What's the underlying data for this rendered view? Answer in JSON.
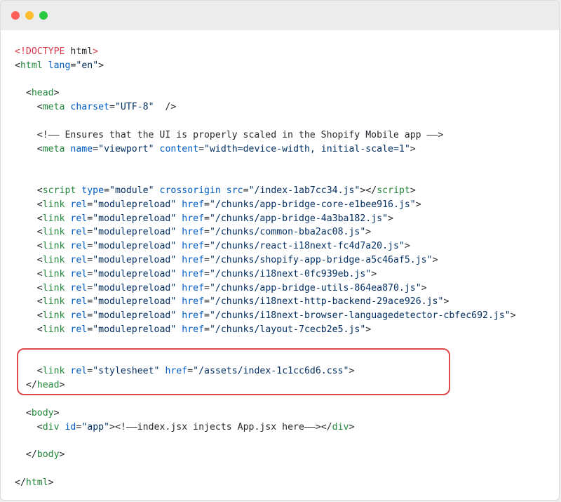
{
  "window": {
    "controls": {
      "close_color": "#ff5f57",
      "minimize_color": "#febc2e",
      "maximize_color": "#28c840"
    }
  },
  "code": {
    "lines": [
      [
        {
          "t": "<!DOCTYPE",
          "c": "c-doctype"
        },
        {
          "t": " html",
          "c": "c-text"
        },
        {
          "t": ">",
          "c": "c-doctype"
        }
      ],
      [
        {
          "t": "<",
          "c": "c-punct"
        },
        {
          "t": "html",
          "c": "c-tag"
        },
        {
          "t": " ",
          "c": "c-text"
        },
        {
          "t": "lang",
          "c": "c-attr"
        },
        {
          "t": "=",
          "c": "c-punct"
        },
        {
          "t": "\"en\"",
          "c": "c-str"
        },
        {
          "t": ">",
          "c": "c-punct"
        }
      ],
      [],
      [
        {
          "t": "  <",
          "c": "c-punct"
        },
        {
          "t": "head",
          "c": "c-tag"
        },
        {
          "t": ">",
          "c": "c-punct"
        }
      ],
      [
        {
          "t": "    <",
          "c": "c-punct"
        },
        {
          "t": "meta",
          "c": "c-tag"
        },
        {
          "t": " ",
          "c": "c-text"
        },
        {
          "t": "charset",
          "c": "c-attr"
        },
        {
          "t": "=",
          "c": "c-punct"
        },
        {
          "t": "\"UTF-8\"",
          "c": "c-str"
        },
        {
          "t": "  />",
          "c": "c-punct"
        }
      ],
      [],
      [
        {
          "t": "    <!—— Ensures that the UI is properly scaled in the Shopify Mobile app ——>",
          "c": "c-comment"
        }
      ],
      [
        {
          "t": "    <",
          "c": "c-punct"
        },
        {
          "t": "meta",
          "c": "c-tag"
        },
        {
          "t": " ",
          "c": "c-text"
        },
        {
          "t": "name",
          "c": "c-attr"
        },
        {
          "t": "=",
          "c": "c-punct"
        },
        {
          "t": "\"viewport\"",
          "c": "c-str"
        },
        {
          "t": " ",
          "c": "c-text"
        },
        {
          "t": "content",
          "c": "c-attr"
        },
        {
          "t": "=",
          "c": "c-punct"
        },
        {
          "t": "\"width=device-width, initial-scale=1\"",
          "c": "c-str"
        },
        {
          "t": ">",
          "c": "c-punct"
        }
      ],
      [],
      [],
      [
        {
          "t": "    <",
          "c": "c-punct"
        },
        {
          "t": "script",
          "c": "c-tag"
        },
        {
          "t": " ",
          "c": "c-text"
        },
        {
          "t": "type",
          "c": "c-attr"
        },
        {
          "t": "=",
          "c": "c-punct"
        },
        {
          "t": "\"module\"",
          "c": "c-str"
        },
        {
          "t": " ",
          "c": "c-text"
        },
        {
          "t": "crossorigin",
          "c": "c-attr"
        },
        {
          "t": " ",
          "c": "c-text"
        },
        {
          "t": "src",
          "c": "c-attr"
        },
        {
          "t": "=",
          "c": "c-punct"
        },
        {
          "t": "\"/index-1ab7cc34.js\"",
          "c": "c-str"
        },
        {
          "t": "></",
          "c": "c-punct"
        },
        {
          "t": "script",
          "c": "c-tag"
        },
        {
          "t": ">",
          "c": "c-punct"
        }
      ],
      [
        {
          "t": "    <",
          "c": "c-punct"
        },
        {
          "t": "link",
          "c": "c-tag"
        },
        {
          "t": " ",
          "c": "c-text"
        },
        {
          "t": "rel",
          "c": "c-attr"
        },
        {
          "t": "=",
          "c": "c-punct"
        },
        {
          "t": "\"modulepreload\"",
          "c": "c-str"
        },
        {
          "t": " ",
          "c": "c-text"
        },
        {
          "t": "href",
          "c": "c-attr"
        },
        {
          "t": "=",
          "c": "c-punct"
        },
        {
          "t": "\"/chunks/app-bridge-core-e1bee916.js\"",
          "c": "c-str"
        },
        {
          "t": ">",
          "c": "c-punct"
        }
      ],
      [
        {
          "t": "    <",
          "c": "c-punct"
        },
        {
          "t": "link",
          "c": "c-tag"
        },
        {
          "t": " ",
          "c": "c-text"
        },
        {
          "t": "rel",
          "c": "c-attr"
        },
        {
          "t": "=",
          "c": "c-punct"
        },
        {
          "t": "\"modulepreload\"",
          "c": "c-str"
        },
        {
          "t": " ",
          "c": "c-text"
        },
        {
          "t": "href",
          "c": "c-attr"
        },
        {
          "t": "=",
          "c": "c-punct"
        },
        {
          "t": "\"/chunks/app-bridge-4a3ba182.js\"",
          "c": "c-str"
        },
        {
          "t": ">",
          "c": "c-punct"
        }
      ],
      [
        {
          "t": "    <",
          "c": "c-punct"
        },
        {
          "t": "link",
          "c": "c-tag"
        },
        {
          "t": " ",
          "c": "c-text"
        },
        {
          "t": "rel",
          "c": "c-attr"
        },
        {
          "t": "=",
          "c": "c-punct"
        },
        {
          "t": "\"modulepreload\"",
          "c": "c-str"
        },
        {
          "t": " ",
          "c": "c-text"
        },
        {
          "t": "href",
          "c": "c-attr"
        },
        {
          "t": "=",
          "c": "c-punct"
        },
        {
          "t": "\"/chunks/common-bba2ac08.js\"",
          "c": "c-str"
        },
        {
          "t": ">",
          "c": "c-punct"
        }
      ],
      [
        {
          "t": "    <",
          "c": "c-punct"
        },
        {
          "t": "link",
          "c": "c-tag"
        },
        {
          "t": " ",
          "c": "c-text"
        },
        {
          "t": "rel",
          "c": "c-attr"
        },
        {
          "t": "=",
          "c": "c-punct"
        },
        {
          "t": "\"modulepreload\"",
          "c": "c-str"
        },
        {
          "t": " ",
          "c": "c-text"
        },
        {
          "t": "href",
          "c": "c-attr"
        },
        {
          "t": "=",
          "c": "c-punct"
        },
        {
          "t": "\"/chunks/react-i18next-fc4d7a20.js\"",
          "c": "c-str"
        },
        {
          "t": ">",
          "c": "c-punct"
        }
      ],
      [
        {
          "t": "    <",
          "c": "c-punct"
        },
        {
          "t": "link",
          "c": "c-tag"
        },
        {
          "t": " ",
          "c": "c-text"
        },
        {
          "t": "rel",
          "c": "c-attr"
        },
        {
          "t": "=",
          "c": "c-punct"
        },
        {
          "t": "\"modulepreload\"",
          "c": "c-str"
        },
        {
          "t": " ",
          "c": "c-text"
        },
        {
          "t": "href",
          "c": "c-attr"
        },
        {
          "t": "=",
          "c": "c-punct"
        },
        {
          "t": "\"/chunks/shopify-app-bridge-a5c46af5.js\"",
          "c": "c-str"
        },
        {
          "t": ">",
          "c": "c-punct"
        }
      ],
      [
        {
          "t": "    <",
          "c": "c-punct"
        },
        {
          "t": "link",
          "c": "c-tag"
        },
        {
          "t": " ",
          "c": "c-text"
        },
        {
          "t": "rel",
          "c": "c-attr"
        },
        {
          "t": "=",
          "c": "c-punct"
        },
        {
          "t": "\"modulepreload\"",
          "c": "c-str"
        },
        {
          "t": " ",
          "c": "c-text"
        },
        {
          "t": "href",
          "c": "c-attr"
        },
        {
          "t": "=",
          "c": "c-punct"
        },
        {
          "t": "\"/chunks/i18next-0fc939eb.js\"",
          "c": "c-str"
        },
        {
          "t": ">",
          "c": "c-punct"
        }
      ],
      [
        {
          "t": "    <",
          "c": "c-punct"
        },
        {
          "t": "link",
          "c": "c-tag"
        },
        {
          "t": " ",
          "c": "c-text"
        },
        {
          "t": "rel",
          "c": "c-attr"
        },
        {
          "t": "=",
          "c": "c-punct"
        },
        {
          "t": "\"modulepreload\"",
          "c": "c-str"
        },
        {
          "t": " ",
          "c": "c-text"
        },
        {
          "t": "href",
          "c": "c-attr"
        },
        {
          "t": "=",
          "c": "c-punct"
        },
        {
          "t": "\"/chunks/app-bridge-utils-864ea870.js\"",
          "c": "c-str"
        },
        {
          "t": ">",
          "c": "c-punct"
        }
      ],
      [
        {
          "t": "    <",
          "c": "c-punct"
        },
        {
          "t": "link",
          "c": "c-tag"
        },
        {
          "t": " ",
          "c": "c-text"
        },
        {
          "t": "rel",
          "c": "c-attr"
        },
        {
          "t": "=",
          "c": "c-punct"
        },
        {
          "t": "\"modulepreload\"",
          "c": "c-str"
        },
        {
          "t": " ",
          "c": "c-text"
        },
        {
          "t": "href",
          "c": "c-attr"
        },
        {
          "t": "=",
          "c": "c-punct"
        },
        {
          "t": "\"/chunks/i18next-http-backend-29ace926.js\"",
          "c": "c-str"
        },
        {
          "t": ">",
          "c": "c-punct"
        }
      ],
      [
        {
          "t": "    <",
          "c": "c-punct"
        },
        {
          "t": "link",
          "c": "c-tag"
        },
        {
          "t": " ",
          "c": "c-text"
        },
        {
          "t": "rel",
          "c": "c-attr"
        },
        {
          "t": "=",
          "c": "c-punct"
        },
        {
          "t": "\"modulepreload\"",
          "c": "c-str"
        },
        {
          "t": " ",
          "c": "c-text"
        },
        {
          "t": "href",
          "c": "c-attr"
        },
        {
          "t": "=",
          "c": "c-punct"
        },
        {
          "t": "\"/chunks/i18next-browser-languagedetector-cbfec692.js\"",
          "c": "c-str"
        },
        {
          "t": ">",
          "c": "c-punct"
        }
      ],
      [
        {
          "t": "    <",
          "c": "c-punct"
        },
        {
          "t": "link",
          "c": "c-tag"
        },
        {
          "t": " ",
          "c": "c-text"
        },
        {
          "t": "rel",
          "c": "c-attr"
        },
        {
          "t": "=",
          "c": "c-punct"
        },
        {
          "t": "\"modulepreload\"",
          "c": "c-str"
        },
        {
          "t": " ",
          "c": "c-text"
        },
        {
          "t": "href",
          "c": "c-attr"
        },
        {
          "t": "=",
          "c": "c-punct"
        },
        {
          "t": "\"/chunks/layout-7cecb2e5.js\"",
          "c": "c-str"
        },
        {
          "t": ">",
          "c": "c-punct"
        }
      ],
      [],
      [],
      [
        {
          "t": "    <",
          "c": "c-punct"
        },
        {
          "t": "link",
          "c": "c-tag"
        },
        {
          "t": " ",
          "c": "c-text"
        },
        {
          "t": "rel",
          "c": "c-attr"
        },
        {
          "t": "=",
          "c": "c-punct"
        },
        {
          "t": "\"stylesheet\"",
          "c": "c-str"
        },
        {
          "t": " ",
          "c": "c-text"
        },
        {
          "t": "href",
          "c": "c-attr"
        },
        {
          "t": "=",
          "c": "c-punct"
        },
        {
          "t": "\"/assets/index-1c1cc6d6.css\"",
          "c": "c-str"
        },
        {
          "t": ">",
          "c": "c-punct"
        }
      ],
      [
        {
          "t": "  </",
          "c": "c-punct"
        },
        {
          "t": "head",
          "c": "c-tag"
        },
        {
          "t": ">",
          "c": "c-punct"
        }
      ],
      [],
      [
        {
          "t": "  <",
          "c": "c-punct"
        },
        {
          "t": "body",
          "c": "c-tag"
        },
        {
          "t": ">",
          "c": "c-punct"
        }
      ],
      [
        {
          "t": "    <",
          "c": "c-punct"
        },
        {
          "t": "div",
          "c": "c-tag"
        },
        {
          "t": " ",
          "c": "c-text"
        },
        {
          "t": "id",
          "c": "c-attr"
        },
        {
          "t": "=",
          "c": "c-punct"
        },
        {
          "t": "\"app\"",
          "c": "c-str"
        },
        {
          "t": "><!——index.jsx injects App.jsx here——></",
          "c": "c-punct"
        },
        {
          "t": "div",
          "c": "c-tag"
        },
        {
          "t": ">",
          "c": "c-punct"
        }
      ],
      [],
      [
        {
          "t": "  </",
          "c": "c-punct"
        },
        {
          "t": "body",
          "c": "c-tag"
        },
        {
          "t": ">",
          "c": "c-punct"
        }
      ],
      [],
      [
        {
          "t": "</",
          "c": "c-punct"
        },
        {
          "t": "html",
          "c": "c-tag"
        },
        {
          "t": ">",
          "c": "c-punct"
        }
      ]
    ],
    "highlight_color": "#e0474c"
  }
}
